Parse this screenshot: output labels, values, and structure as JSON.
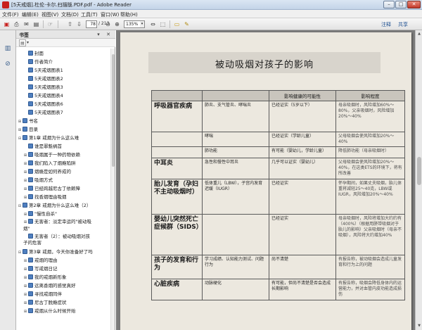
{
  "window": {
    "title": "[5天戒烟].杜伦·卡尔.扫描版.PDF.pdf - Adobe Reader",
    "minimize": "–",
    "maximize": "□",
    "close": "✕"
  },
  "menu": [
    "文件(F)",
    "编辑(E)",
    "视图(V)",
    "文档(D)",
    "工具(T)",
    "窗口(W)",
    "帮助(H)"
  ],
  "toolbar": {
    "page_number": "78",
    "page_total": "/ 213",
    "zoom": "135%",
    "comment_label": "注释",
    "share_label": "共享",
    "icons": [
      "open-icon",
      "print-icon",
      "email-icon",
      "save-icon",
      "prev-page-icon",
      "next-page-icon",
      "zoom-out-icon",
      "zoom-in-icon",
      "fit-icon",
      "comment-icon",
      "highlight-icon"
    ]
  },
  "bookmarks_panel": {
    "title": "书签",
    "close": "✕",
    "options": "▾",
    "items": [
      {
        "label": "封面",
        "level": 1,
        "toggle": ""
      },
      {
        "label": "作者简介",
        "level": 1,
        "toggle": ""
      },
      {
        "label": "5天戒烟图表1",
        "level": 1,
        "toggle": ""
      },
      {
        "label": "5天戒烟图表2",
        "level": 1,
        "toggle": ""
      },
      {
        "label": "5天戒烟图表3",
        "level": 1,
        "toggle": ""
      },
      {
        "label": "5天戒烟图表4",
        "level": 1,
        "toggle": ""
      },
      {
        "label": "5天戒烟图表6",
        "level": 1,
        "toggle": ""
      },
      {
        "label": "5天戒烟图表7",
        "level": 1,
        "toggle": ""
      },
      {
        "label": "书名",
        "level": 0,
        "toggle": "⊞"
      },
      {
        "label": "目录",
        "level": 0,
        "toggle": "⊞"
      },
      {
        "label": "第1章 戒烟为什么这么难",
        "level": 0,
        "toggle": "⊟"
      },
      {
        "label": "谁是罪魁祸首",
        "level": 1,
        "toggle": ""
      },
      {
        "label": "吸烟属于一种药物依赖",
        "level": 1,
        "toggle": "⊞"
      },
      {
        "label": "我们陷入了烟瘾陷阱",
        "level": 1,
        "toggle": "⊞"
      },
      {
        "label": "烟瘾是如何养成的",
        "level": 1,
        "toggle": "⊞"
      },
      {
        "label": "吸烟方式",
        "level": 1,
        "toggle": "⊞"
      },
      {
        "label": "已经跨越尼古丁依赖障",
        "level": 1,
        "toggle": "⊞"
      },
      {
        "label": "找香烟理由吸烟",
        "level": 1,
        "toggle": "⊞"
      },
      {
        "label": "第2章 戒烟为什么这么难（2）",
        "level": 0,
        "toggle": "⊟"
      },
      {
        "label": "\"慢性自杀\"",
        "level": 1,
        "toggle": "⊞"
      },
      {
        "label": "无害者：淡定幸运的\"被动吸烟\"",
        "level": 1,
        "toggle": "⊞"
      },
      {
        "label": "无害者（2）：被动吸烟对孩子的危害",
        "level": 1,
        "toggle": ""
      },
      {
        "label": "第3章 戒烟，今天你准备好了吗",
        "level": 0,
        "toggle": "⊟"
      },
      {
        "label": "戒烟的理由",
        "level": 1,
        "toggle": "⊞"
      },
      {
        "label": "写戒烟日记",
        "level": 1,
        "toggle": "⊞"
      },
      {
        "label": "我的戒烟新形象",
        "level": 1,
        "toggle": "⊞"
      },
      {
        "label": "远离香烟的感觉真好",
        "level": 1,
        "toggle": "⊞"
      },
      {
        "label": "寻找戒烟同伴",
        "level": 1,
        "toggle": "⊞"
      },
      {
        "label": "尼古丁脱瘾症状",
        "level": 1,
        "toggle": "⊞"
      },
      {
        "label": "戒烟从什么时候开始",
        "level": 1,
        "toggle": "⊞"
      }
    ]
  },
  "document": {
    "page_title": "被动吸烟对孩子的影响",
    "table": {
      "headers": [
        "",
        "",
        "影响健康的可能性",
        "影响程度"
      ],
      "rows": [
        {
          "category": "呼吸器官疾病",
          "disease": "肺炎、支气管炎、哮喘炎",
          "likelihood": "已经证实（5岁以下）",
          "level": "母亲吸烟时，风险增加60%～80%，父亲吸烟时，风险增加20%～40%"
        },
        {
          "category": "",
          "disease": "哮喘",
          "likelihood": "已经证实（学龄儿童）",
          "level": "父母吸烟会使风险增加20%～40%"
        },
        {
          "category": "",
          "disease": "肺功能",
          "likelihood": "有可能（婴幼儿，学龄儿童）",
          "level": "降低肺功能（母亲吸烟时）"
        },
        {
          "category": "中耳炎",
          "disease": "急性和慢性中耳炎",
          "likelihood": "几乎可以证实（婴幼儿）",
          "level": "父母吸烟会使风险增加20%～40%，在这类ETS的环境下，将有所改善"
        },
        {
          "category": "胎儿发育（孕妇不主动吸烟时）",
          "disease": "低体重儿（LBW），子宫内发育迟缓（IUGR）",
          "likelihood": "已经证实",
          "level": "怀孕期间，如果丈夫吸烟，胎儿体重将减轻25～40克，LBW或IUGR，风险增加20%～40%"
        },
        {
          "category": "婴幼儿突然死亡症候群（SIDS）",
          "disease": "",
          "likelihood": "已经证实",
          "level": "母亲吸烟时，风险将增加大约约有（400%）（根据用脐带吸烟对于胎儿的影响）父亲吸烟时（母亲不吸烟），风险将大约增加40%"
        },
        {
          "category": "孩子的发育和行为",
          "disease": "学习成绩、认知能力测试、问题行为",
          "likelihood": "尚不清楚",
          "level": "有报告称，被动吸烟会造成儿童发育和行为上的问题"
        },
        {
          "category": "心脏疾病",
          "disease": "动脉硬化",
          "likelihood": "有可能，但尚不清楚是否会造成长期影响",
          "level": "有报告称，吸烟会降低身体内的运营能力，并对血管内皮功能造成损伤"
        }
      ]
    }
  }
}
